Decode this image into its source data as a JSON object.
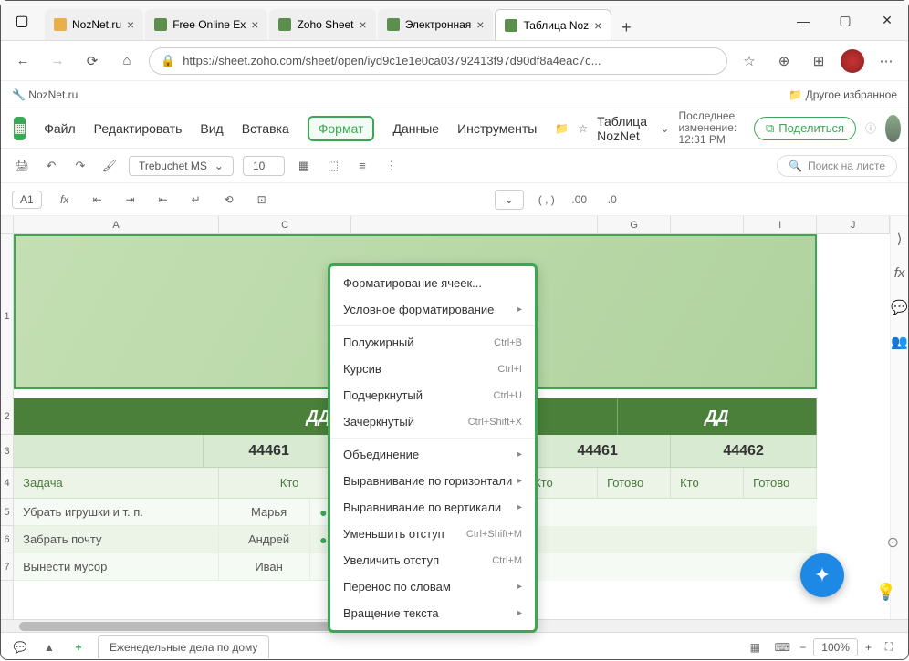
{
  "browser": {
    "tabs": [
      {
        "label": "NozNet.ru"
      },
      {
        "label": "Free Online Ex"
      },
      {
        "label": "Zoho Sheet"
      },
      {
        "label": "Электронная"
      },
      {
        "label": "Таблица Noz"
      }
    ],
    "url": "https://sheet.zoho.com/sheet/open/iyd9c1e1e0ca03792413f97d90df8a4eac7c...",
    "bookmark": "NozNet.ru",
    "otherfav": "Другое избранное"
  },
  "app": {
    "docname": "Таблица NozNet",
    "lastchange_label": "Последнее изменение:",
    "lastchange_time": "12:31 PM",
    "share": "Поделиться",
    "menu": {
      "file": "Файл",
      "edit": "Редактировать",
      "view": "Вид",
      "insert": "Вставка",
      "format": "Формат",
      "data": "Данные",
      "tools": "Инструменты"
    },
    "font": "Trebuchet MS",
    "fontsize": "10",
    "search": "Поиск на листе",
    "cellref": "A1",
    "sheet_tab": "Еженедельные дела по дому",
    "zoom": "100%"
  },
  "cols": [
    "A",
    "C",
    "G",
    "I",
    "J"
  ],
  "header_dd": "ДД",
  "dates": [
    "44461",
    "44461",
    "44462"
  ],
  "sub": {
    "task": "Задача",
    "who": "Кто",
    "done": "Готово"
  },
  "rows": [
    {
      "task": "Убрать игрушки и т. п.",
      "who": "Марья",
      "done": "Готово"
    },
    {
      "task": "Забрать почту",
      "who": "Андрей",
      "done": "Готово"
    },
    {
      "task": "Вынести мусор",
      "who": "Иван",
      "done": ""
    }
  ],
  "menuitems": [
    {
      "label": "Форматирование ячеек...",
      "sc": "",
      "sub": false
    },
    {
      "label": "Условное форматирование",
      "sc": "",
      "sub": true,
      "sep": true
    },
    {
      "label": "Полужирный",
      "sc": "Ctrl+B",
      "sub": false
    },
    {
      "label": "Курсив",
      "sc": "Ctrl+I",
      "sub": false
    },
    {
      "label": "Подчеркнутый",
      "sc": "Ctrl+U",
      "sub": false
    },
    {
      "label": "Зачеркнутый",
      "sc": "Ctrl+Shift+X",
      "sub": false,
      "sep": true
    },
    {
      "label": "Объединение",
      "sc": "",
      "sub": true
    },
    {
      "label": "Выравнивание по горизонтали",
      "sc": "",
      "sub": true
    },
    {
      "label": "Выравнивание по вертикали",
      "sc": "",
      "sub": true
    },
    {
      "label": "Уменьшить отступ",
      "sc": "Ctrl+Shift+M",
      "sub": false
    },
    {
      "label": "Увеличить отступ",
      "sc": "Ctrl+M",
      "sub": false
    },
    {
      "label": "Перенос по словам",
      "sc": "",
      "sub": true
    },
    {
      "label": "Вращение текста",
      "sc": "",
      "sub": true
    }
  ]
}
